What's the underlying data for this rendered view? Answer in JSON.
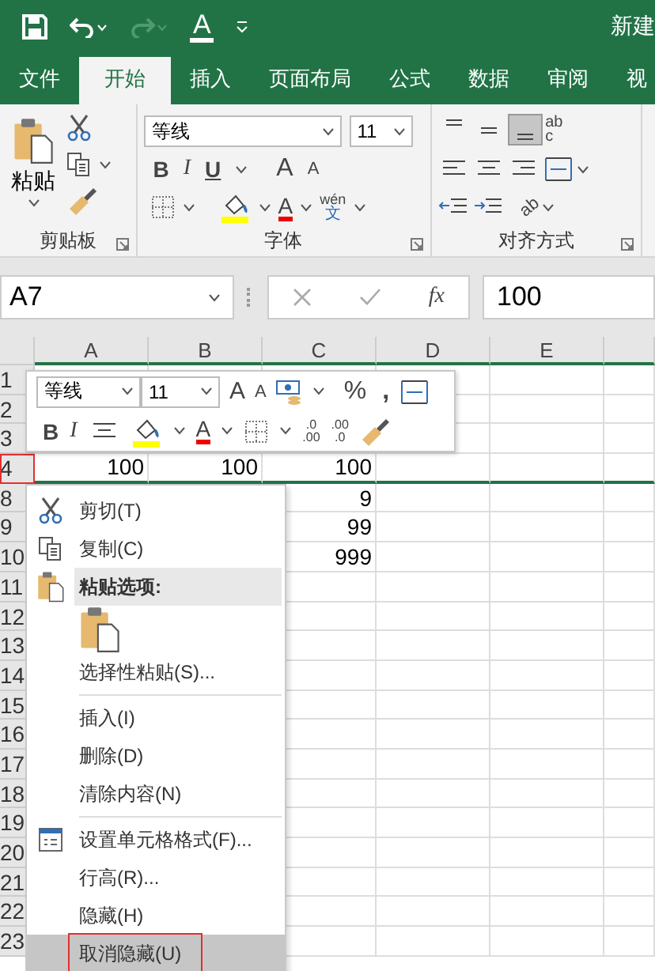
{
  "title_bar": {
    "font_color_glyph": "A",
    "title": "新建"
  },
  "ribbon_tabs": [
    {
      "label": "文件",
      "selected": false
    },
    {
      "label": "开始",
      "selected": true
    },
    {
      "label": "插入",
      "selected": false
    },
    {
      "label": "页面布局",
      "selected": false
    },
    {
      "label": "公式",
      "selected": false
    },
    {
      "label": "数据",
      "selected": false
    },
    {
      "label": "审阅",
      "selected": false
    },
    {
      "label": "视",
      "selected": false
    }
  ],
  "ribbon": {
    "clipboard": {
      "paste_label": "粘贴",
      "group_label": "剪贴板"
    },
    "font": {
      "font_name": "等线",
      "font_size": "11",
      "bold": "B",
      "italic": "I",
      "underline": "U",
      "grow": "A",
      "shrink": "A",
      "font_color": "A",
      "phonetic_top": "wén",
      "phonetic_bottom": "文",
      "group_label": "字体"
    },
    "alignment": {
      "wrap_top": "ab",
      "wrap_bottom": "c",
      "orientation": "ab",
      "group_label": "对齐方式"
    }
  },
  "formula_bar": {
    "name_box": "A7",
    "fx": "fx",
    "value": "100"
  },
  "sheet": {
    "columns": [
      "A",
      "B",
      "C",
      "D",
      "E"
    ],
    "rows": [
      {
        "header": "1",
        "cells": [
          "",
          "",
          ""
        ],
        "annotated": false
      },
      {
        "header": "2",
        "cells": [
          "",
          "",
          ""
        ],
        "annotated": false
      },
      {
        "header": "3",
        "cells": [
          "",
          "",
          ""
        ],
        "annotated": false
      },
      {
        "header": "4",
        "cells": [
          "100",
          "100",
          "100"
        ],
        "annotated": true
      },
      {
        "header": "8",
        "cells": [
          "",
          "",
          "9"
        ],
        "annotated": false
      },
      {
        "header": "9",
        "cells": [
          "",
          "",
          "99"
        ],
        "annotated": false
      },
      {
        "header": "10",
        "cells": [
          "",
          "",
          "999"
        ],
        "annotated": false
      },
      {
        "header": "11",
        "cells": [
          "",
          "",
          ""
        ],
        "annotated": false
      },
      {
        "header": "12",
        "cells": [
          "",
          "",
          ""
        ],
        "annotated": false
      },
      {
        "header": "13",
        "cells": [
          "",
          "",
          ""
        ],
        "annotated": false
      },
      {
        "header": "14",
        "cells": [
          "",
          "",
          ""
        ],
        "annotated": false
      },
      {
        "header": "15",
        "cells": [
          "",
          "",
          ""
        ],
        "annotated": false
      },
      {
        "header": "16",
        "cells": [
          "",
          "",
          ""
        ],
        "annotated": false
      },
      {
        "header": "17",
        "cells": [
          "",
          "",
          ""
        ],
        "annotated": false
      },
      {
        "header": "18",
        "cells": [
          "",
          "",
          ""
        ],
        "annotated": false
      },
      {
        "header": "19",
        "cells": [
          "",
          "",
          ""
        ],
        "annotated": false
      },
      {
        "header": "20",
        "cells": [
          "",
          "",
          ""
        ],
        "annotated": false
      },
      {
        "header": "21",
        "cells": [
          "",
          "",
          ""
        ],
        "annotated": false
      },
      {
        "header": "22",
        "cells": [
          "",
          "",
          ""
        ],
        "annotated": false
      },
      {
        "header": "23",
        "cells": [
          "",
          "",
          ""
        ],
        "annotated": false
      }
    ]
  },
  "mini_toolbar": {
    "font_name": "等线",
    "font_size": "11",
    "grow": "A",
    "shrink": "A",
    "percent": "%",
    "comma": ",",
    "bold": "B",
    "italic": "I",
    "font_color": "A",
    "inc_decimal_top": ".0",
    "inc_decimal_bottom": ".00",
    "dec_decimal_top": ".00",
    "dec_decimal_bottom": ".0"
  },
  "context_menu": [
    {
      "kind": "cut",
      "label": "剪切(T)",
      "selected": false,
      "divider_after": false,
      "annotated": false
    },
    {
      "kind": "copy",
      "label": "复制(C)",
      "selected": false,
      "divider_after": false,
      "annotated": false
    },
    {
      "kind": "header",
      "label": "粘贴选项:",
      "selected": false,
      "divider_after": false,
      "annotated": false
    },
    {
      "kind": "paste",
      "selected": false,
      "divider_after": false,
      "annotated": false
    },
    {
      "kind": "plain",
      "label": "选择性粘贴(S)...",
      "selected": false,
      "divider_after": true,
      "annotated": false
    },
    {
      "kind": "plain",
      "label": "插入(I)",
      "selected": false,
      "divider_after": false,
      "annotated": false
    },
    {
      "kind": "plain",
      "label": "删除(D)",
      "selected": false,
      "divider_after": false,
      "annotated": false
    },
    {
      "kind": "plain",
      "label": "清除内容(N)",
      "selected": false,
      "divider_after": true,
      "annotated": false
    },
    {
      "kind": "format",
      "label": "设置单元格格式(F)...",
      "selected": false,
      "divider_after": false,
      "annotated": false
    },
    {
      "kind": "plain",
      "label": "行高(R)...",
      "selected": false,
      "divider_after": false,
      "annotated": false
    },
    {
      "kind": "plain",
      "label": "隐藏(H)",
      "selected": false,
      "divider_after": false,
      "annotated": false
    },
    {
      "kind": "plain",
      "label": "取消隐藏(U)",
      "selected": true,
      "divider_after": false,
      "annotated": true
    }
  ]
}
